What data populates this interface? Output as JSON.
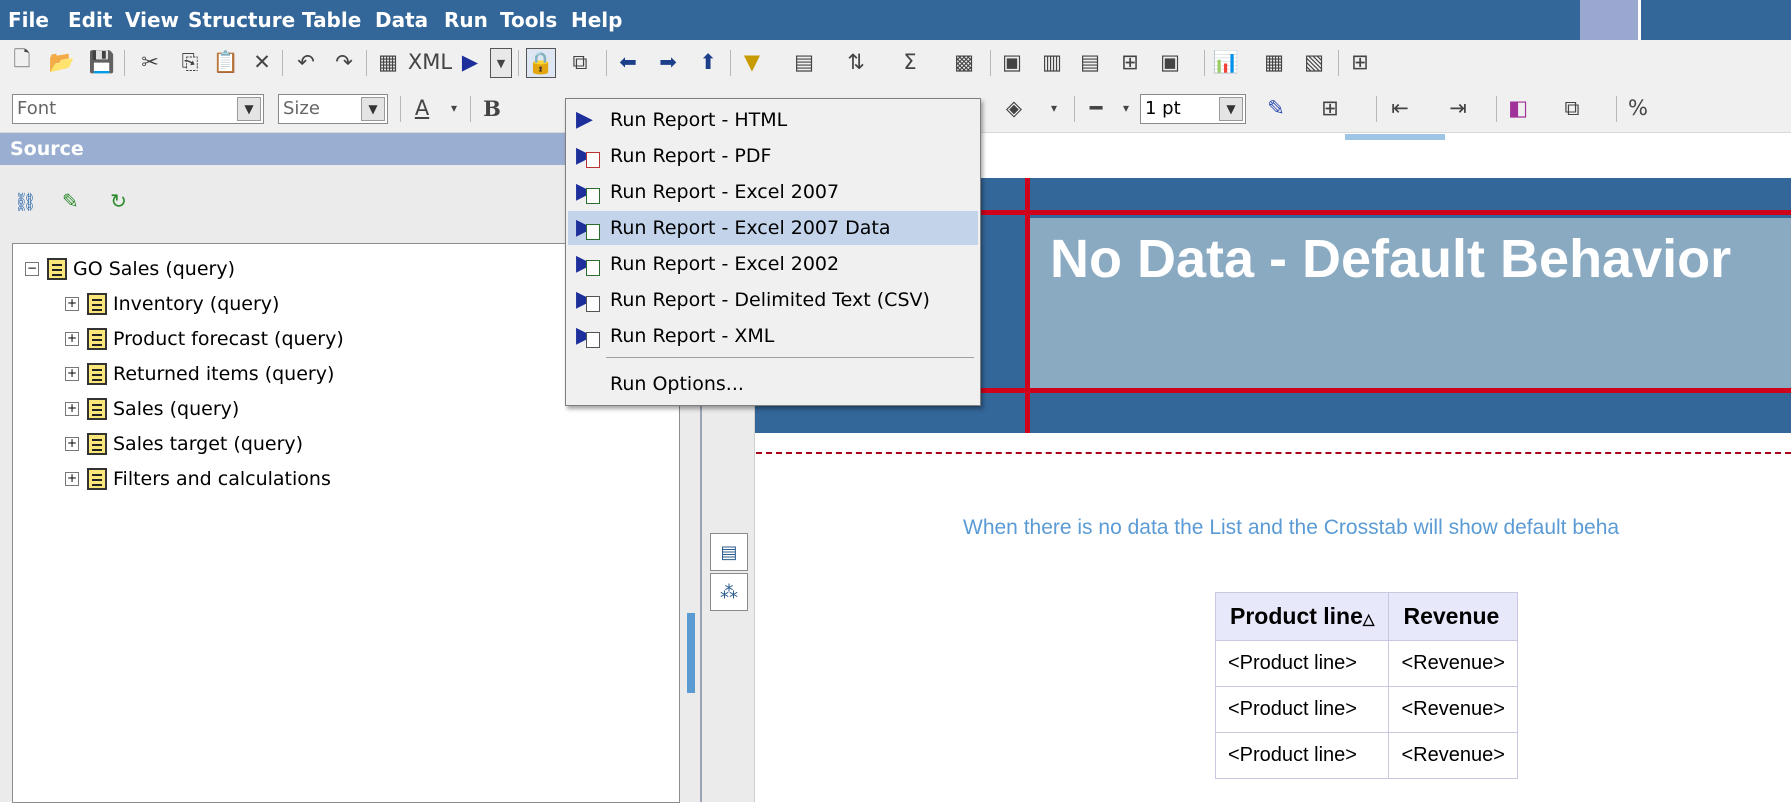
{
  "menubar": {
    "items": [
      "File",
      "Edit",
      "View",
      "Structure",
      "Table",
      "Data",
      "Run",
      "Tools",
      "Help"
    ]
  },
  "toolbar2": {
    "font_placeholder": "Font",
    "size_placeholder": "Size",
    "border_width": "1 pt"
  },
  "source_panel": {
    "title": "Source",
    "tree": {
      "root": "GO Sales (query)",
      "children": [
        "Inventory (query)",
        "Product forecast (query)",
        "Returned items (query)",
        "Sales (query)",
        "Sales target (query)",
        "Filters and calculations"
      ]
    }
  },
  "run_menu": {
    "items": [
      "Run Report - HTML",
      "Run Report - PDF",
      "Run Report - Excel 2007",
      "Run Report - Excel 2007 Data",
      "Run Report - Excel 2002",
      "Run Report - Delimited Text (CSV)",
      "Run Report - XML"
    ],
    "selected_index": 3,
    "options_label": "Run Options..."
  },
  "report": {
    "title": "No Data - Default Behavior",
    "note": "When there is no data the List and the Crosstab will show default beha",
    "list": {
      "headers": [
        "Product line",
        "Revenue"
      ],
      "sort_indicator": "△",
      "rows": [
        [
          "<Product line>",
          "<Revenue>"
        ],
        [
          "<Product line>",
          "<Revenue>"
        ],
        [
          "<Product line>",
          "<Revenue>"
        ]
      ]
    }
  },
  "colors": {
    "menubar": "#336699",
    "banner": "#336699",
    "title_cell": "#8aaac2",
    "banner_lines": "#d0021b",
    "note_text": "#5b9bd5",
    "selected_item": "#c3d3ea"
  }
}
